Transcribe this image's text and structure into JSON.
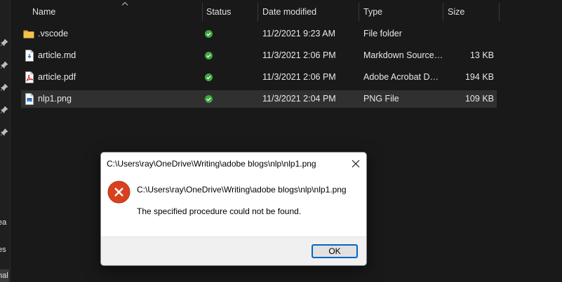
{
  "columns": {
    "name": "Name",
    "status": "Status",
    "date_modified": "Date modified",
    "type": "Type",
    "size": "Size"
  },
  "files": [
    {
      "name": ".vscode",
      "date": "11/2/2021 9:23 AM",
      "type": "File folder",
      "size": "",
      "icon": "folder-icon",
      "status": "synced-icon",
      "selected": false
    },
    {
      "name": "article.md",
      "date": "11/3/2021 2:06 PM",
      "type": "Markdown Source…",
      "size": "13 KB",
      "icon": "markdown-file-icon",
      "status": "synced-icon",
      "selected": false
    },
    {
      "name": "article.pdf",
      "date": "11/3/2021 2:06 PM",
      "type": "Adobe Acrobat D…",
      "size": "194 KB",
      "icon": "pdf-file-icon",
      "status": "synced-icon",
      "selected": false
    },
    {
      "name": "nlp1.png",
      "date": "11/3/2021 2:04 PM",
      "type": "PNG File",
      "size": "109 KB",
      "icon": "png-file-icon",
      "status": "synced-icon",
      "selected": true
    }
  ],
  "nav_fragments": [
    "ea",
    "es",
    "nal"
  ],
  "dialog": {
    "title": "C:\\Users\\ray\\OneDrive\\Writing\\adobe blogs\\nlp\\nlp1.png",
    "path": "C:\\Users\\ray\\OneDrive\\Writing\\adobe blogs\\nlp\\nlp1.png",
    "message": "The specified procedure could not be found.",
    "ok_label": "OK"
  },
  "colors": {
    "background": "#191919",
    "selected_row": "#303030",
    "status_green": "#3fa642",
    "error_red": "#d9411e",
    "accent_blue": "#0067c0",
    "folder_yellow": "#f2c24a"
  }
}
